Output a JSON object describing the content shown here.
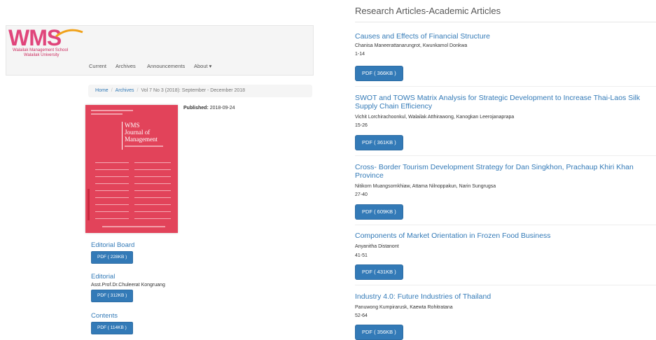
{
  "brand": {
    "name": "WMS",
    "line1": "Walailak Management School",
    "line2": "Walailak University"
  },
  "nav": [
    "Current",
    "Archives",
    "Announcements",
    "About ▾"
  ],
  "breadcrumb": {
    "home": "Home",
    "archives": "Archives",
    "current": "Vol 7 No 3 (2018): September - December 2018"
  },
  "cover": {
    "title_line1": "WMS",
    "title_line2": "Journal of",
    "title_line3": "Management",
    "color": "#e2435a"
  },
  "published": {
    "label": "Published:",
    "date": "2018-09-24"
  },
  "left_sections": [
    {
      "title": "Editorial Board",
      "author": "",
      "pdf": "PDF ( 228KB )"
    },
    {
      "title": "Editorial",
      "author": "Asst.Prof.Dr.Chuleerat Kongruang",
      "pdf": "PDF ( 312KB )"
    },
    {
      "title": "Contents",
      "author": "",
      "pdf": "PDF ( 114KB )"
    }
  ],
  "section_heading": "Research Articles-Academic Articles",
  "articles": [
    {
      "title": "Causes and Effects of Financial Structure",
      "authors": "Chanisa Maneerattanarungrot, Kwunkamol Donkwa",
      "pages": "1-14",
      "pdf": "PDF ( 366KB )"
    },
    {
      "title": "SWOT and TOWS Matrix Analysis for Strategic Development to Increase Thai-Laos Silk Supply Chain Efficiency",
      "authors": "Vichit Lorchirachoonkul, Walailak Atthirawong, Kanogkan Leerojanaprapa",
      "pages": "15-26",
      "pdf": "PDF ( 361KB )"
    },
    {
      "title": "Cross- Border Tourism Development Strategy for Dan Singkhon, Prachaup Khiri Khan Province",
      "authors": "Nitikorn Muangsornkhiaw, Attama Nilnoppakun, Narin Sungrugsa",
      "pages": "27-40",
      "pdf": "PDF ( 609KB )"
    },
    {
      "title": "Components of Market Orientation in Frozen Food Business",
      "authors": "Anyanitha Distanont",
      "pages": "41-51",
      "pdf": "PDF ( 431KB )"
    },
    {
      "title": "Industry 4.0: Future Industries of Thailand",
      "authors": "Panuwong Kumpirarusk, Kaewta Rohitratana",
      "pages": "52-64",
      "pdf": "PDF ( 356KB )"
    }
  ]
}
